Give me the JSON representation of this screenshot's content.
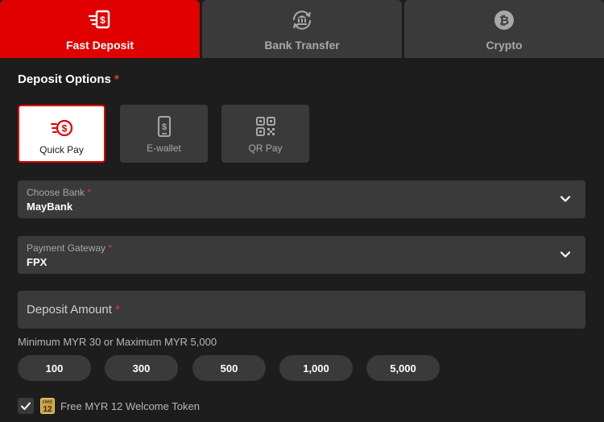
{
  "tabs": [
    {
      "label": "Fast Deposit",
      "icon": "fast-money-icon",
      "active": true
    },
    {
      "label": "Bank Transfer",
      "icon": "bank-transfer-icon",
      "active": false
    },
    {
      "label": "Crypto",
      "icon": "bitcoin-icon",
      "active": false
    }
  ],
  "deposit_options": {
    "title": "Deposit Options",
    "required_mark": "*",
    "items": [
      {
        "label": "Quick Pay",
        "icon": "quick-pay-icon",
        "selected": true
      },
      {
        "label": "E-wallet",
        "icon": "ewallet-icon",
        "selected": false
      },
      {
        "label": "QR Pay",
        "icon": "qr-icon",
        "selected": false
      }
    ]
  },
  "choose_bank": {
    "label": "Choose Bank",
    "required_mark": "*",
    "value": "MayBank"
  },
  "payment_gateway": {
    "label": "Payment Gateway",
    "required_mark": "*",
    "value": "FPX"
  },
  "deposit_amount": {
    "placeholder": "Deposit Amount",
    "required_mark": "*"
  },
  "limits_text": "Minimum MYR 30 or Maximum MYR 5,000",
  "quick_amounts": [
    "100",
    "300",
    "500",
    "1,000",
    "5,000"
  ],
  "promo": {
    "checked": true,
    "badge": "FREE 12",
    "text": "Free MYR 12 Welcome Token"
  },
  "colors": {
    "accent": "#e00000",
    "background": "#1d1d1d",
    "panel": "#3a3a3a"
  }
}
